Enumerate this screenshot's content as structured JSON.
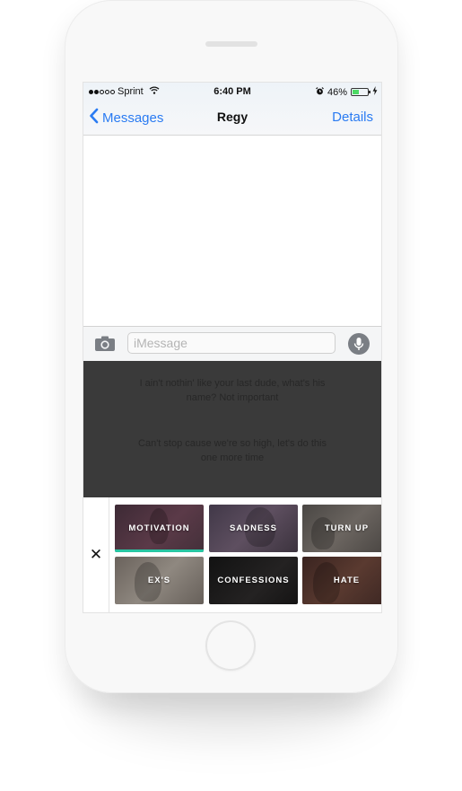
{
  "status_bar": {
    "carrier": "Sprint",
    "signal_bars_filled": 2,
    "signal_bars_total": 5,
    "time": "6:40 PM",
    "battery_percent": "46%",
    "battery_level": 0.46,
    "battery_color": "#4cd964",
    "icons": [
      "wifi-icon",
      "alarm-icon",
      "battery-icon",
      "charging-bolt-icon"
    ]
  },
  "nav": {
    "back_label": "Messages",
    "title": "Regy",
    "details_label": "Details",
    "accent_color": "#2a7bf2"
  },
  "composer": {
    "placeholder": "iMessage",
    "camera_icon": "camera-icon",
    "mic_icon": "microphone-icon"
  },
  "lyrics": [
    "I ain't nothin' like your last dude, what's his name? Not important",
    "Can't stop cause we're so high, let's do this one more time"
  ],
  "keyboard": {
    "close_label": "✕",
    "selected_color": "#28c6a3",
    "categories": [
      {
        "label": "MOTIVATION",
        "selected": true
      },
      {
        "label": "SADNESS",
        "selected": false
      },
      {
        "label": "TURN UP",
        "selected": false
      },
      {
        "label": "EX'S",
        "selected": false
      },
      {
        "label": "CONFESSIONS",
        "selected": false
      },
      {
        "label": "HATE",
        "selected": false
      }
    ]
  }
}
